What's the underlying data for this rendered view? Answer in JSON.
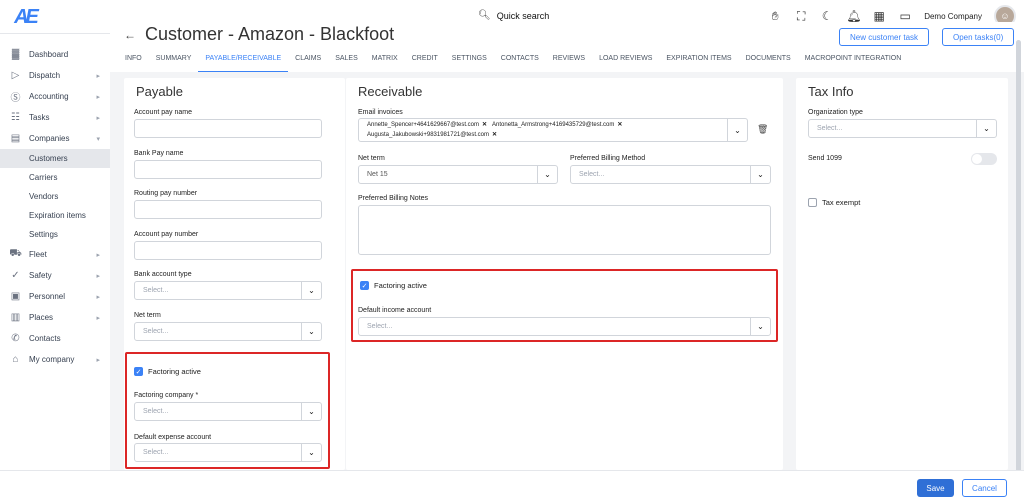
{
  "app": {
    "logo_text": "AE",
    "search_label": "Quick search",
    "company_name": "Demo Company"
  },
  "sidebar": {
    "items": [
      {
        "label": "Dashboard",
        "icon": "chart-icon",
        "arrow": false
      },
      {
        "label": "Dispatch",
        "icon": "send-icon",
        "arrow": true
      },
      {
        "label": "Accounting",
        "icon": "dollar-icon",
        "arrow": true
      },
      {
        "label": "Tasks",
        "icon": "clipboard-icon",
        "arrow": true
      },
      {
        "label": "Companies",
        "icon": "building-icon",
        "arrow": true,
        "expanded": true
      }
    ],
    "sub_items": [
      "Customers",
      "Carriers",
      "Vendors",
      "Expiration items",
      "Settings"
    ],
    "active_sub": "Customers",
    "items_after": [
      {
        "label": "Fleet",
        "icon": "truck-icon"
      },
      {
        "label": "Safety",
        "icon": "shield-icon"
      },
      {
        "label": "Personnel",
        "icon": "id-card-icon"
      },
      {
        "label": "Places",
        "icon": "map-icon"
      },
      {
        "label": "Contacts",
        "icon": "phone-icon"
      },
      {
        "label": "My company",
        "icon": "home-icon"
      }
    ]
  },
  "header": {
    "title": "Customer - Amazon - Blackfoot",
    "new_task_button": "New customer task",
    "open_tasks_button": "Open tasks(0)",
    "tabs": [
      "INFO",
      "SUMMARY",
      "PAYABLE/RECEIVABLE",
      "CLAIMS",
      "SALES",
      "MATRIX",
      "CREDIT",
      "SETTINGS",
      "CONTACTS",
      "REVIEWS",
      "LOAD REVIEWS",
      "EXPIRATION ITEMS",
      "DOCUMENTS",
      "MACROPOINT INTEGRATION"
    ],
    "active_tab": "PAYABLE/RECEIVABLE"
  },
  "payable": {
    "title": "Payable",
    "account_pay_name_label": "Account pay name",
    "bank_pay_name_label": "Bank Pay name",
    "routing_pay_number_label": "Routing pay number",
    "account_pay_number_label": "Account pay number",
    "bank_account_type_label": "Bank account type",
    "bank_account_type_placeholder": "Select...",
    "net_term_label": "Net term",
    "net_term_placeholder": "Select...",
    "factoring_active_label": "Factoring active",
    "factoring_active_checked": true,
    "factoring_company_label": "Factoring company *",
    "factoring_company_placeholder": "Select...",
    "default_expense_account_label": "Default expense account",
    "default_expense_account_placeholder": "Select..."
  },
  "receivable": {
    "title": "Receivable",
    "email_invoices_label": "Email invoices",
    "emails": [
      "Annette_Spencer+4641629667@test.com",
      "Antonetta_Armstrong+4169435729@test.com",
      "Augusta_Jakubowski+9831981721@test.com"
    ],
    "net_term_label": "Net term",
    "net_term_value": "Net 15",
    "preferred_billing_method_label": "Preferred Billing Method",
    "preferred_billing_method_placeholder": "Select...",
    "preferred_billing_notes_label": "Preferred Billing Notes",
    "factoring_active_label": "Factoring active",
    "factoring_active_checked": true,
    "default_income_account_label": "Default income account",
    "default_income_account_placeholder": "Select..."
  },
  "tax": {
    "title": "Tax Info",
    "organization_type_label": "Organization type",
    "organization_type_placeholder": "Select...",
    "send_1099_label": "Send 1099",
    "send_1099_on": false,
    "tax_exempt_label": "Tax exempt",
    "tax_exempt_checked": false
  },
  "footer": {
    "save_label": "Save",
    "cancel_label": "Cancel"
  },
  "colors": {
    "accent": "#3b82f6",
    "highlight": "#dc2626",
    "save": "#2f6fd6"
  }
}
